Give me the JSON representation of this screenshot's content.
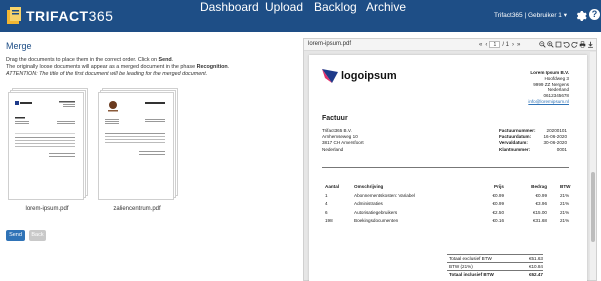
{
  "app": {
    "logo_text_bold": "TRIFACT",
    "logo_text_num": "365",
    "brand_color": "#1e4e86"
  },
  "nav": {
    "items": [
      {
        "label": "Dashboard"
      },
      {
        "label": "Upload"
      },
      {
        "label": "Backlog"
      },
      {
        "label": "Archive"
      }
    ],
    "user": "Trifact365 | Gebruiker 1",
    "user_caret": "▾",
    "help_label": "?"
  },
  "merge": {
    "title": "Merge",
    "instr_line1_pre": "Drag the documents to place them in the correct order. Click on ",
    "instr_line1_bold": "Send",
    "instr_line1_post": ".",
    "instr_line2_pre": "The originally loose documents will appear as a merged document in the phase ",
    "instr_line2_bold": "Recognition",
    "instr_line2_post": ".",
    "instr_line3": "ATTENTION: The title of the first document will be leading for the merged document.",
    "documents": [
      {
        "label": "lorem-ipsum.pdf"
      },
      {
        "label": "zaliencentrum.pdf"
      }
    ],
    "send_label": "Send",
    "back_label": "Back"
  },
  "viewer": {
    "filename": "lorem-ipsum.pdf",
    "first_label": "«",
    "prev_label": "‹",
    "page_current": "1",
    "page_total": "/ 1",
    "next_label": "›",
    "last_label": "»",
    "icons": [
      "zoom-out-icon",
      "zoom-in-icon",
      "fit-page-icon",
      "rotate-left-icon",
      "rotate-right-icon",
      "print-icon",
      "download-icon"
    ]
  },
  "invoice": {
    "logo_text": "logoipsum",
    "sender": {
      "name": "Lorem Ipsum B.V.",
      "street": "Hoofdweg 3",
      "city": "9999 ZZ  Nergens",
      "country": "Nederland",
      "phone": "0612345678",
      "email": "info@loremipsum.nl"
    },
    "title": "Factuur",
    "recipient": [
      "Trifact365 B.V.",
      "Arnhemseweg 10",
      "3817 CH  Amersfoort",
      "Nederland"
    ],
    "meta": [
      {
        "k": "Factuurnummer:",
        "v": "20200101"
      },
      {
        "k": "Factuurdatum:",
        "v": "16-06-2020"
      },
      {
        "k": "Vervaldatum:",
        "v": "30-06-2020"
      },
      {
        "k": "Klantnummer:",
        "v": "0001"
      }
    ],
    "columns": {
      "aantal": "Aantal",
      "omschrijving": "Omschrijving",
      "prijs": "Prijs",
      "bedrag": "Bedrag",
      "btw": "BTW"
    },
    "lines": [
      {
        "aantal": "1",
        "omschrijving": "Abonnementskosten: Variabel",
        "prijs": "€0.99",
        "bedrag": "€0.99",
        "btw": "21%"
      },
      {
        "aantal": "4",
        "omschrijving": "Administraties",
        "prijs": "€0.99",
        "bedrag": "€3.96",
        "btw": "21%"
      },
      {
        "aantal": "6",
        "omschrijving": "Autorisatiegebruikers",
        "prijs": "€2.50",
        "bedrag": "€15.00",
        "btw": "21%"
      },
      {
        "aantal": "198",
        "omschrijving": "Boekingsdocumenten",
        "prijs": "€0.16",
        "bedrag": "€31.68",
        "btw": "21%"
      }
    ],
    "totals": [
      {
        "k": "Totaal exclusief BTW",
        "v": "€51.63"
      },
      {
        "k": "BTW (21%)",
        "v": "€10.84"
      },
      {
        "k": "Totaal inclusief BTW",
        "v": "€62.47"
      }
    ]
  }
}
